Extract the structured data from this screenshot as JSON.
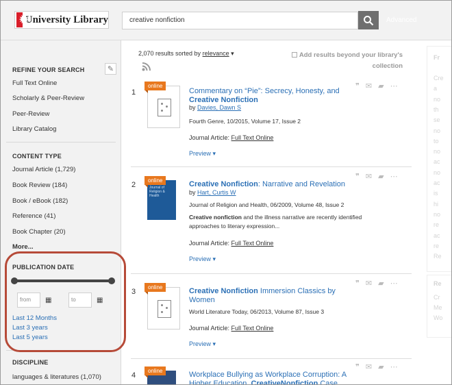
{
  "header": {
    "logo_text": "University Library",
    "search_value": "creative nonfiction",
    "advanced_label": "Advanced"
  },
  "sidebar": {
    "refine_heading": "REFINE YOUR SEARCH",
    "refine_items": [
      "Full Text Online",
      "Scholarly & Peer-Review",
      "Peer-Review",
      "Library Catalog"
    ],
    "content_type_heading": "CONTENT TYPE",
    "content_type_items": [
      "Journal Article (1,729)",
      "Book Review (184)",
      "Book / eBook (182)",
      "Reference (41)",
      "Book Chapter (20)"
    ],
    "more_label": "More...",
    "pub_date_heading": "PUBLICATION DATE",
    "from_placeholder": "from",
    "to_placeholder": "to",
    "date_links": [
      "Last 12 Months",
      "Last 3 years",
      "Last 5 years"
    ],
    "discipline_heading": "DISCIPLINE",
    "discipline_items": [
      "languages & literatures (1,070)"
    ]
  },
  "results_header": {
    "count_text": "2,070 results sorted by",
    "sort_value": "relevance",
    "beyond_label": "Add results beyond your library's collection"
  },
  "results": [
    {
      "number": "1",
      "badge": "online",
      "title_pre": "Commentary on “Pie”: Secrecy, Honesty, and ",
      "title_bold": "Creative Nonfiction",
      "title_post": "",
      "by": "by",
      "author": "Davies, Dawn S",
      "meta": "Fourth Genre, 10/2015, Volume 17, Issue 2",
      "snippet_bold": "",
      "snippet": "",
      "type": "Journal Article:",
      "fulltext": "Full Text Online",
      "preview": "Preview"
    },
    {
      "number": "2",
      "badge": "online",
      "title_pre": "",
      "title_bold": "Creative Nonfiction",
      "title_post": ": Narrative and Revelation",
      "by": "by",
      "author": "Hart, Curtis W",
      "meta": "Journal of Religion and Health, 06/2009, Volume 48, Issue 2",
      "snippet_bold": "Creative nonfiction",
      "snippet": " and the illness narrative are recently identified approaches to literary expression...",
      "type": "Journal Article:",
      "fulltext": "Full Text Online",
      "preview": "Preview"
    },
    {
      "number": "3",
      "badge": "online",
      "title_pre": "",
      "title_bold": "Creative Nonfiction",
      "title_post": " Immersion Classics by Women",
      "by": "",
      "author": "",
      "meta": "World Literature Today, 06/2013, Volume 87, Issue 3",
      "snippet_bold": "",
      "snippet": "",
      "type": "Journal Article:",
      "fulltext": "Full Text Online",
      "preview": "Preview"
    },
    {
      "number": "4",
      "badge": "online",
      "title_pre": "Workplace Bullying as Workplace Corruption: A Higher Education, ",
      "title_bold": "CreativeNonfiction",
      "title_post": " Case"
    }
  ],
  "cover_text": "Journal of Religion & Health",
  "right_panel": {
    "lines_a": [
      "Fr",
      "Cre",
      "a",
      "no",
      "th",
      "se",
      "no",
      "to",
      "no",
      "ac",
      "no",
      "ac",
      "is",
      "hi",
      "no",
      "re",
      "ac",
      "re",
      "Re"
    ],
    "lines_b": [
      "Re",
      "Cr",
      "Me",
      "Wo"
    ]
  },
  "colors": {
    "accent": "#2a6fb5",
    "badge": "#e8781e",
    "brand": "#d91e2a",
    "highlight": "#b64a38"
  }
}
